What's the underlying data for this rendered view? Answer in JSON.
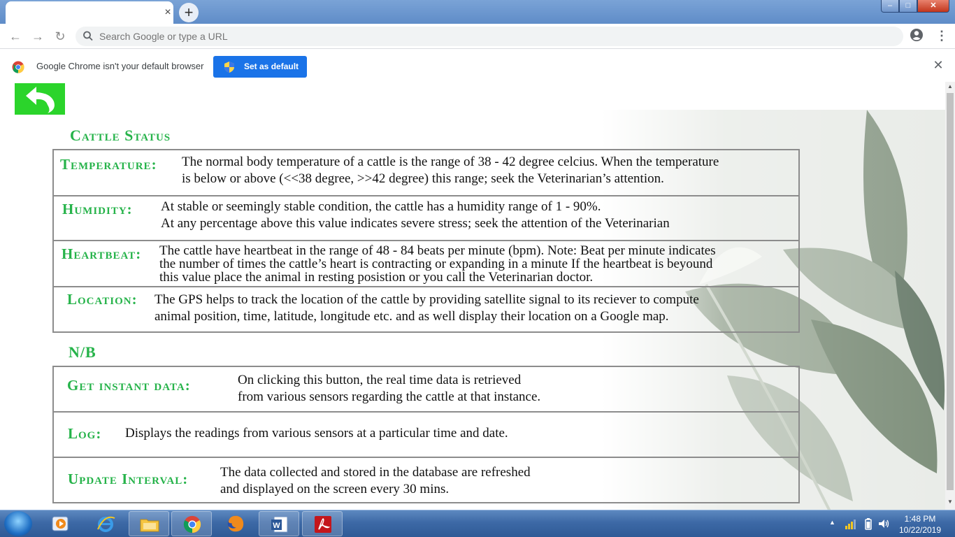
{
  "browser": {
    "tab_close": "×",
    "new_tab": "+",
    "omnibox_placeholder": "Search Google or type a URL",
    "window_controls": {
      "minimize": "–",
      "maximize": "□",
      "close": "✕"
    }
  },
  "infobar": {
    "message": "Google Chrome isn't your default browser",
    "button_label": "Set as default",
    "close": "✕"
  },
  "page": {
    "title": "Cattle Status",
    "status_rows": [
      {
        "label": "Temperature:",
        "lines": [
          "The normal body temperature of a cattle is the range of 38 - 42 degree celcius. When the temperature",
          "is below or above (<<38 degree, >>42 degree) this range; seek the Veterinarian’s attention."
        ]
      },
      {
        "label": "Humidity:",
        "lines": [
          "At stable or seemingly stable condition, the cattle has a humidity range of 1 - 90%.",
          "At any percentage above this value indicates severe stress; seek the attention of the Veterinarian"
        ]
      },
      {
        "label": "Heartbeat:",
        "lines": [
          "The cattle have heartbeat in the range of 48 - 84 beats per minute (bpm). Note: Beat per minute indicates",
          "the number of times the cattle’s heart is contracting or expanding in a minute If the heartbeat is beyound",
          "this value place the animal in resting posistion or you call the Veterinarian doctor."
        ]
      },
      {
        "label": "Location:",
        "lines": [
          "The GPS helps to track the location of the cattle by providing satellite signal to its reciever to compute",
          "animal position, time, latitude, longitude etc. and as well display their location on a Google map."
        ]
      }
    ],
    "nb_title": "N/B",
    "nb_rows": [
      {
        "label": "Get instant data:",
        "lines": [
          "On clicking this button, the real time data is retrieved",
          "from various sensors regarding the cattle at that instance."
        ]
      },
      {
        "label": "Log:",
        "lines": [
          "Displays the readings from various sensors at a particular time and date."
        ]
      },
      {
        "label": "Update Interval:",
        "lines": [
          "The data collected and stored in the database are refreshed",
          "and displayed on the screen every 30 mins."
        ]
      }
    ]
  },
  "taskbar": {
    "time": "1:48 PM",
    "date": "10/22/2019"
  },
  "colors": {
    "accent_green": "#26b34a",
    "back_button": "#2bd42b",
    "chrome_blue": "#1a73e8"
  }
}
